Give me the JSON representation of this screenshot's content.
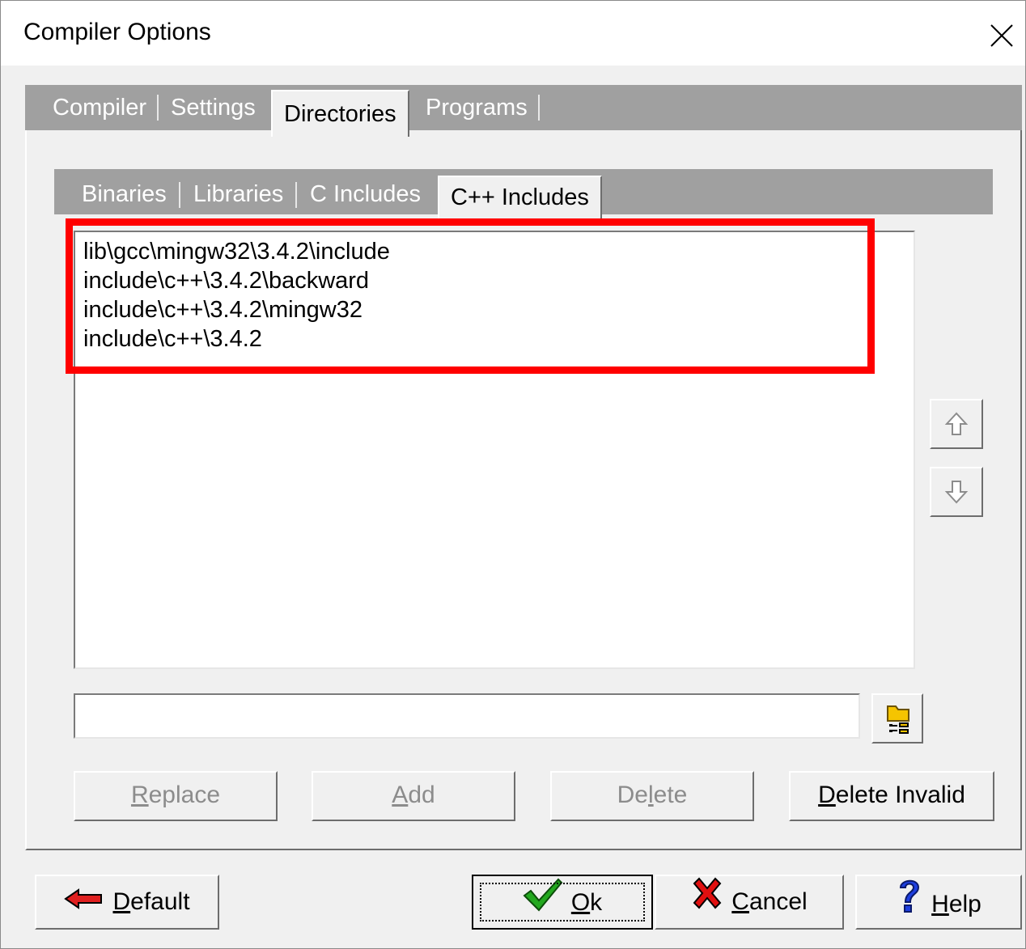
{
  "window": {
    "title": "Compiler Options"
  },
  "tabs": [
    {
      "label": "Compiler"
    },
    {
      "label": "Settings"
    },
    {
      "label": "Directories",
      "active": true
    },
    {
      "label": "Programs"
    }
  ],
  "subtabs": [
    {
      "label": "Binaries"
    },
    {
      "label": "Libraries"
    },
    {
      "label": "C Includes"
    },
    {
      "label": "C++ Includes",
      "active": true
    }
  ],
  "directories": [
    "lib\\gcc\\mingw32\\3.4.2\\include",
    "include\\c++\\3.4.2\\backward",
    "include\\c++\\3.4.2\\mingw32",
    "include\\c++\\3.4.2"
  ],
  "path_input": {
    "value": ""
  },
  "actions": {
    "replace": {
      "first": "R",
      "rest": "eplace",
      "enabled": false
    },
    "add": {
      "first": "A",
      "rest": "dd",
      "enabled": false
    },
    "delete": {
      "pre": "De",
      "ul": "l",
      "post": "ete",
      "enabled": false
    },
    "delete_invalid": {
      "first": "D",
      "rest": "elete Invalid",
      "enabled": true
    }
  },
  "footer": {
    "default": {
      "first": "D",
      "rest": "efault"
    },
    "ok": {
      "first": "O",
      "rest": "k"
    },
    "cancel": {
      "first": "C",
      "rest": "ancel"
    },
    "help": {
      "first": "H",
      "rest": "elp"
    }
  },
  "icons": {
    "close": "close-icon",
    "move_up": "arrow-up-icon",
    "move_down": "arrow-down-icon",
    "browse": "folder-browse-icon",
    "default": "red-left-arrow-icon",
    "ok": "green-check-icon",
    "cancel": "red-x-icon",
    "help": "blue-question-icon"
  },
  "colors": {
    "highlight": "#ff0000",
    "tab_strip": "#a0a0a0",
    "dialog_bg": "#f0f0f0"
  }
}
